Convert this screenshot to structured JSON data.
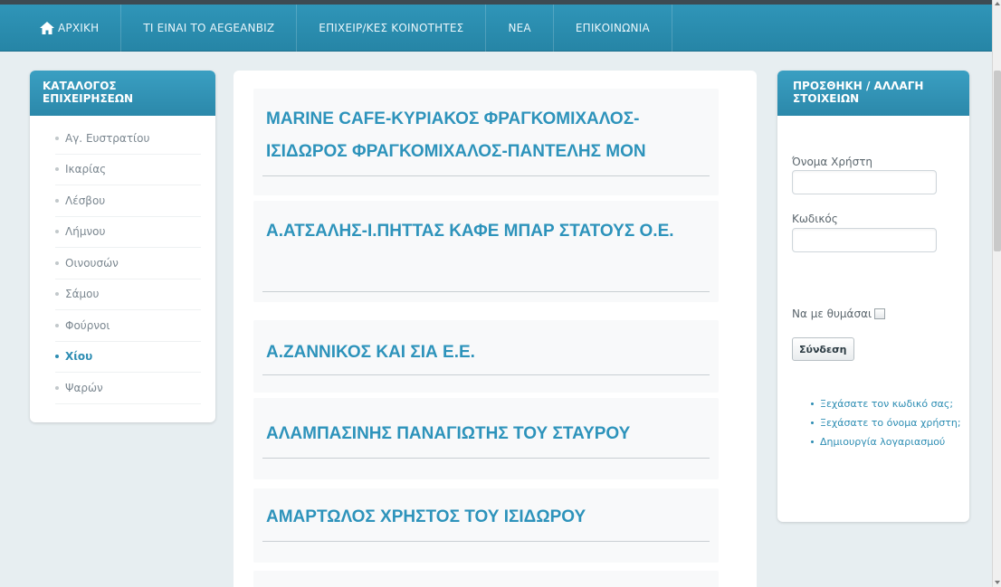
{
  "nav": {
    "items": [
      "ΑΡΧΙΚΗ",
      "ΤΙ ΕΙΝΑΙ ΤΟ AEGEANBIZ",
      "ΕΠΙΧΕΙΡ/ΚΕΣ ΚΟΙΝΟΤΗΤΕΣ",
      "ΝΕΑ",
      "ΕΠΙΚΟΙΝΩΝΙΑ"
    ]
  },
  "left_panel": {
    "title": "ΚΑΤΑΛΟΓΟΣ ΕΠΙΧΕΙΡΗΣΕΩΝ",
    "items": [
      "Αγ. Ευστρατίου",
      "Ικαρίας",
      "Λέσβου",
      "Λήμνου",
      "Οινουσών",
      "Σάμου",
      "Φούρνοι",
      "Χίου",
      "Ψαρών"
    ],
    "active": "Χίου"
  },
  "businesses": [
    "MARINE CAFE-ΚΥΡΙΑΚΟΣ ΦΡΑΓΚΟΜΙΧΑΛΟΣ-ΙΣΙΔΩΡΟΣ ΦΡΑΓΚΟΜΙΧΑΛΟΣ-ΠΑΝΤΕΛΗΣ ΜΟΝ",
    "Α.ΑΤΣΑΛΗΣ-Ι.ΠΗΤΤΑΣ ΚΑΦΕ ΜΠΑΡ ΣΤΑΤΟΥΣ Ο.Ε.",
    "Α.ΖΑΝΝΙΚΟΣ ΚΑΙ ΣΙΑ Ε.Ε.",
    "ΑΛΑΜΠΑΣΙΝΗΣ ΠΑΝΑΓΙΩΤΗΣ ΤΟΥ ΣΤΑΥΡΟΥ",
    "ΑΜΑΡΤΩΛΟΣ ΧΡΗΣΤΟΣ ΤΟΥ ΙΣΙΔΩΡΟΥ"
  ],
  "login": {
    "title": "ΠΡΟΣΘΗΚΗ / ΑΛΛΑΓΗ ΣΤΟΙΧΕΙΩΝ",
    "username_label": "Όνομα Χρήστη",
    "username_value": "",
    "password_label": "Κωδικός",
    "password_value": "",
    "remember_label": "Να με θυμάσαι",
    "remember_checked": false,
    "submit_label": "Σύνδεση",
    "links": [
      "Ξεχάσατε τον κωδικό σας;",
      "Ξεχάσατε το όνομα χρήστη;",
      "Δημιουργία λογαριασμού"
    ]
  },
  "colors": {
    "nav_bg": "#2a8cae",
    "accent": "#2d93bb",
    "page_bg": "#e7eef1"
  }
}
